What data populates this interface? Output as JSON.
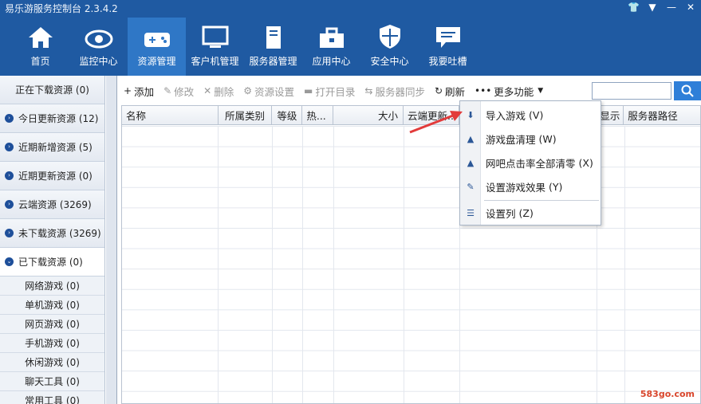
{
  "app": {
    "title": "易乐游服务控制台 2.3.4.2"
  },
  "nav": [
    {
      "label": "首页",
      "icon": "home-icon"
    },
    {
      "label": "监控中心",
      "icon": "eye-icon"
    },
    {
      "label": "资源管理",
      "icon": "gamepad-icon",
      "active": true
    },
    {
      "label": "客户机管理",
      "icon": "monitor-icon"
    },
    {
      "label": "服务器管理",
      "icon": "server-icon"
    },
    {
      "label": "应用中心",
      "icon": "toolbox-icon"
    },
    {
      "label": "安全中心",
      "icon": "shield-icon"
    },
    {
      "label": "我要吐槽",
      "icon": "chat-icon"
    }
  ],
  "sidebar": {
    "groups": [
      {
        "label": "正在下载资源 (0)",
        "dot": false
      },
      {
        "label": "今日更新资源 (12)",
        "dot": true
      },
      {
        "label": "近期新增资源 (5)",
        "dot": true
      },
      {
        "label": "近期更新资源 (0)",
        "dot": true
      },
      {
        "label": "云端资源 (3269)",
        "dot": true
      },
      {
        "label": "未下载资源 (3269)",
        "dot": true
      },
      {
        "label": "已下载资源 (0)",
        "dot": true,
        "active": true
      }
    ],
    "subitems": [
      {
        "label": "网络游戏 (0)"
      },
      {
        "label": "单机游戏 (0)"
      },
      {
        "label": "网页游戏 (0)"
      },
      {
        "label": "手机游戏 (0)"
      },
      {
        "label": "休闲游戏 (0)"
      },
      {
        "label": "聊天工具 (0)"
      },
      {
        "label": "常用工具 (0)"
      }
    ]
  },
  "toolbar": {
    "add": "添加",
    "edit": "修改",
    "delete": "删除",
    "resource_settings": "资源设置",
    "open_dir": "打开目录",
    "server_sync": "服务器同步",
    "refresh": "刷新",
    "more": "更多功能"
  },
  "search": {
    "placeholder": ""
  },
  "table": {
    "columns": [
      "名称",
      "所属类别",
      "等级",
      "热...",
      "大小",
      "云端更新...",
      "",
      "显示",
      "服务器路径"
    ]
  },
  "menu": {
    "items": [
      {
        "label": "导入游戏",
        "key": "(V)",
        "icon": "import-icon"
      },
      {
        "label": "游戏盘清理",
        "key": "(W)",
        "icon": "clean-icon"
      },
      {
        "label": "网吧点击率全部清零",
        "key": "(X)",
        "icon": "reset-icon"
      },
      {
        "label": "设置游戏效果",
        "key": "(Y)",
        "icon": "wrench-icon"
      },
      {
        "label": "设置列",
        "key": "(Z)",
        "icon": "columns-icon"
      }
    ]
  },
  "watermark": "583go.com",
  "colors": {
    "header": "#1f5aa2",
    "active_nav": "#2f77c6",
    "accent": "#2f7fd8"
  }
}
